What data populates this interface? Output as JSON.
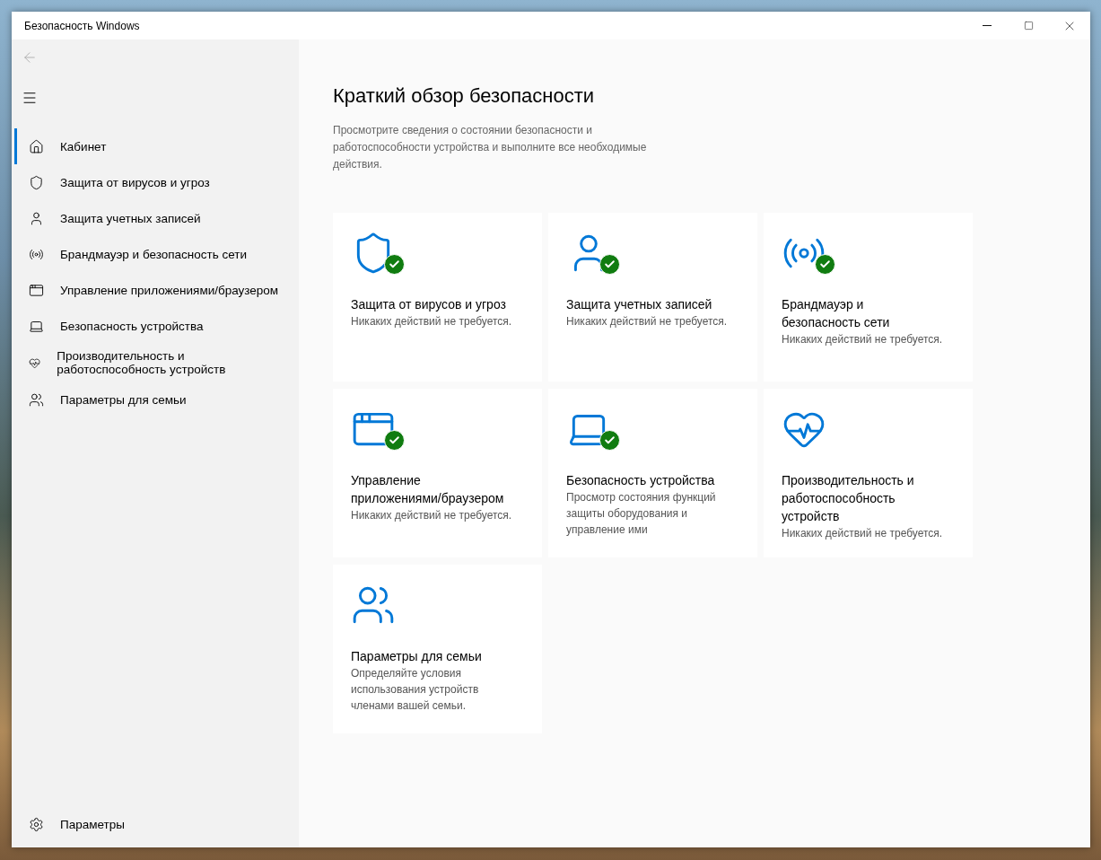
{
  "window": {
    "title": "Безопасность Windows"
  },
  "sidebar": {
    "items": [
      {
        "kind": "home",
        "label": "Кабинет",
        "selected": true
      },
      {
        "kind": "shield",
        "label": "Защита от вирусов и угроз",
        "selected": false
      },
      {
        "kind": "person",
        "label": "Защита учетных записей",
        "selected": false
      },
      {
        "kind": "antenna",
        "label": "Брандмауэр и безопасность сети",
        "selected": false
      },
      {
        "kind": "browser",
        "label": "Управление приложениями/браузером",
        "selected": false
      },
      {
        "kind": "laptop",
        "label": "Безопасность устройства",
        "selected": false
      },
      {
        "kind": "heart",
        "label": "Производительность и работоспособность устройств",
        "selected": false
      },
      {
        "kind": "family",
        "label": "Параметры для семьи",
        "selected": false
      }
    ],
    "footer": {
      "kind": "gear",
      "label": "Параметры"
    }
  },
  "page": {
    "title": "Краткий обзор безопасности",
    "description": "Просмотрите сведения о состоянии безопасности и работоспособности устройства и выполните все необходимые действия.",
    "tiles": [
      {
        "kind": "shield",
        "title": "Защита от вирусов и угроз",
        "status": "Никаких действий не требуется.",
        "ok": true
      },
      {
        "kind": "person",
        "title": "Защита учетных записей",
        "status": "Никаких действий не требуется.",
        "ok": true
      },
      {
        "kind": "antenna",
        "title": "Брандмауэр и безопасность сети",
        "status": "Никаких действий не требуется.",
        "ok": true
      },
      {
        "kind": "browser",
        "title": "Управление приложениями/браузером",
        "status": "Никаких действий не требуется.",
        "ok": true
      },
      {
        "kind": "laptop",
        "title": "Безопасность устройства",
        "status": "Просмотр состояния функций защиты оборудования и управление ими",
        "ok": true
      },
      {
        "kind": "heart",
        "title": "Производительность и работоспособность устройств",
        "status": "Никаких действий не требуется.",
        "ok": false
      },
      {
        "kind": "family",
        "title": "Параметры для семьи",
        "status": "Определяйте условия использования устройств членами вашей семьи.",
        "ok": false
      }
    ]
  }
}
